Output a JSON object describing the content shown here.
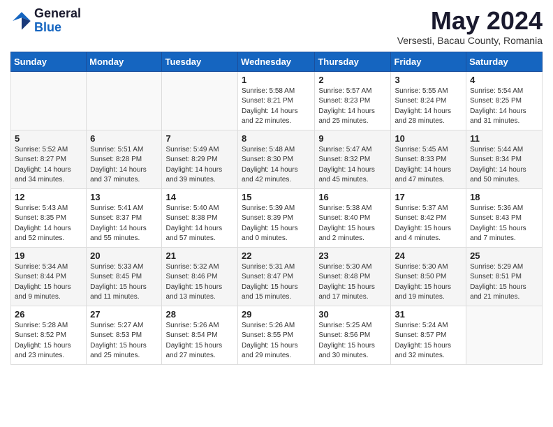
{
  "header": {
    "logo_general": "General",
    "logo_blue": "Blue",
    "month_title": "May 2024",
    "location": "Versesti, Bacau County, Romania"
  },
  "days_of_week": [
    "Sunday",
    "Monday",
    "Tuesday",
    "Wednesday",
    "Thursday",
    "Friday",
    "Saturday"
  ],
  "weeks": [
    [
      {
        "day": "",
        "info": ""
      },
      {
        "day": "",
        "info": ""
      },
      {
        "day": "",
        "info": ""
      },
      {
        "day": "1",
        "info": "Sunrise: 5:58 AM\nSunset: 8:21 PM\nDaylight: 14 hours\nand 22 minutes."
      },
      {
        "day": "2",
        "info": "Sunrise: 5:57 AM\nSunset: 8:23 PM\nDaylight: 14 hours\nand 25 minutes."
      },
      {
        "day": "3",
        "info": "Sunrise: 5:55 AM\nSunset: 8:24 PM\nDaylight: 14 hours\nand 28 minutes."
      },
      {
        "day": "4",
        "info": "Sunrise: 5:54 AM\nSunset: 8:25 PM\nDaylight: 14 hours\nand 31 minutes."
      }
    ],
    [
      {
        "day": "5",
        "info": "Sunrise: 5:52 AM\nSunset: 8:27 PM\nDaylight: 14 hours\nand 34 minutes."
      },
      {
        "day": "6",
        "info": "Sunrise: 5:51 AM\nSunset: 8:28 PM\nDaylight: 14 hours\nand 37 minutes."
      },
      {
        "day": "7",
        "info": "Sunrise: 5:49 AM\nSunset: 8:29 PM\nDaylight: 14 hours\nand 39 minutes."
      },
      {
        "day": "8",
        "info": "Sunrise: 5:48 AM\nSunset: 8:30 PM\nDaylight: 14 hours\nand 42 minutes."
      },
      {
        "day": "9",
        "info": "Sunrise: 5:47 AM\nSunset: 8:32 PM\nDaylight: 14 hours\nand 45 minutes."
      },
      {
        "day": "10",
        "info": "Sunrise: 5:45 AM\nSunset: 8:33 PM\nDaylight: 14 hours\nand 47 minutes."
      },
      {
        "day": "11",
        "info": "Sunrise: 5:44 AM\nSunset: 8:34 PM\nDaylight: 14 hours\nand 50 minutes."
      }
    ],
    [
      {
        "day": "12",
        "info": "Sunrise: 5:43 AM\nSunset: 8:35 PM\nDaylight: 14 hours\nand 52 minutes."
      },
      {
        "day": "13",
        "info": "Sunrise: 5:41 AM\nSunset: 8:37 PM\nDaylight: 14 hours\nand 55 minutes."
      },
      {
        "day": "14",
        "info": "Sunrise: 5:40 AM\nSunset: 8:38 PM\nDaylight: 14 hours\nand 57 minutes."
      },
      {
        "day": "15",
        "info": "Sunrise: 5:39 AM\nSunset: 8:39 PM\nDaylight: 15 hours\nand 0 minutes."
      },
      {
        "day": "16",
        "info": "Sunrise: 5:38 AM\nSunset: 8:40 PM\nDaylight: 15 hours\nand 2 minutes."
      },
      {
        "day": "17",
        "info": "Sunrise: 5:37 AM\nSunset: 8:42 PM\nDaylight: 15 hours\nand 4 minutes."
      },
      {
        "day": "18",
        "info": "Sunrise: 5:36 AM\nSunset: 8:43 PM\nDaylight: 15 hours\nand 7 minutes."
      }
    ],
    [
      {
        "day": "19",
        "info": "Sunrise: 5:34 AM\nSunset: 8:44 PM\nDaylight: 15 hours\nand 9 minutes."
      },
      {
        "day": "20",
        "info": "Sunrise: 5:33 AM\nSunset: 8:45 PM\nDaylight: 15 hours\nand 11 minutes."
      },
      {
        "day": "21",
        "info": "Sunrise: 5:32 AM\nSunset: 8:46 PM\nDaylight: 15 hours\nand 13 minutes."
      },
      {
        "day": "22",
        "info": "Sunrise: 5:31 AM\nSunset: 8:47 PM\nDaylight: 15 hours\nand 15 minutes."
      },
      {
        "day": "23",
        "info": "Sunrise: 5:30 AM\nSunset: 8:48 PM\nDaylight: 15 hours\nand 17 minutes."
      },
      {
        "day": "24",
        "info": "Sunrise: 5:30 AM\nSunset: 8:50 PM\nDaylight: 15 hours\nand 19 minutes."
      },
      {
        "day": "25",
        "info": "Sunrise: 5:29 AM\nSunset: 8:51 PM\nDaylight: 15 hours\nand 21 minutes."
      }
    ],
    [
      {
        "day": "26",
        "info": "Sunrise: 5:28 AM\nSunset: 8:52 PM\nDaylight: 15 hours\nand 23 minutes."
      },
      {
        "day": "27",
        "info": "Sunrise: 5:27 AM\nSunset: 8:53 PM\nDaylight: 15 hours\nand 25 minutes."
      },
      {
        "day": "28",
        "info": "Sunrise: 5:26 AM\nSunset: 8:54 PM\nDaylight: 15 hours\nand 27 minutes."
      },
      {
        "day": "29",
        "info": "Sunrise: 5:26 AM\nSunset: 8:55 PM\nDaylight: 15 hours\nand 29 minutes."
      },
      {
        "day": "30",
        "info": "Sunrise: 5:25 AM\nSunset: 8:56 PM\nDaylight: 15 hours\nand 30 minutes."
      },
      {
        "day": "31",
        "info": "Sunrise: 5:24 AM\nSunset: 8:57 PM\nDaylight: 15 hours\nand 32 minutes."
      },
      {
        "day": "",
        "info": ""
      }
    ]
  ]
}
